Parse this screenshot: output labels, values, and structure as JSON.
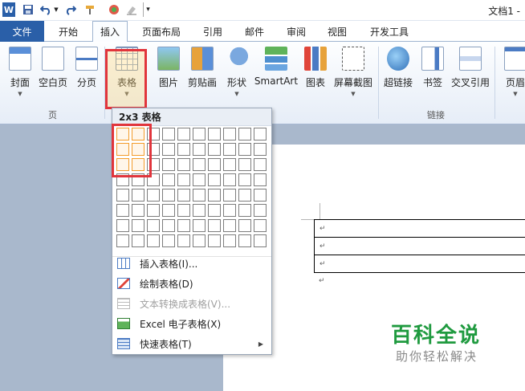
{
  "window": {
    "title": "文档1 -"
  },
  "quick_access": {
    "icons": [
      "word-app-icon",
      "save-icon",
      "undo-icon",
      "dropdown-icon",
      "redo-icon",
      "format-painter-icon",
      "color-icon",
      "eraser-icon",
      "customize-icon"
    ]
  },
  "tabs": [
    {
      "label": "文件"
    },
    {
      "label": "开始"
    },
    {
      "label": "插入"
    },
    {
      "label": "页面布局"
    },
    {
      "label": "引用"
    },
    {
      "label": "邮件"
    },
    {
      "label": "审阅"
    },
    {
      "label": "视图"
    },
    {
      "label": "开发工具"
    }
  ],
  "ribbon": {
    "buttons": [
      {
        "label": "封面"
      },
      {
        "label": "空白页"
      },
      {
        "label": "分页"
      },
      {
        "label": "表格"
      },
      {
        "label": "图片"
      },
      {
        "label": "剪贴画"
      },
      {
        "label": "形状"
      },
      {
        "label": "SmartArt"
      },
      {
        "label": "图表"
      },
      {
        "label": "屏幕截图"
      },
      {
        "label": "超链接"
      },
      {
        "label": "书签"
      },
      {
        "label": "交叉引用"
      },
      {
        "label": "页眉"
      }
    ],
    "groups": {
      "pages": "页",
      "links": "链接"
    }
  },
  "table_dropdown": {
    "header": "2x3 表格",
    "grid": {
      "columns": 10,
      "rows": 8,
      "selected_columns": 2,
      "selected_rows": 3
    },
    "menu": [
      {
        "label": "插入表格(I)...",
        "enabled": true,
        "icon": "insert-table-icon"
      },
      {
        "label": "绘制表格(D)",
        "enabled": true,
        "icon": "draw-table-icon"
      },
      {
        "label": "文本转换成表格(V)...",
        "enabled": false,
        "icon": "text-to-table-icon"
      },
      {
        "label": "Excel 电子表格(X)",
        "enabled": true,
        "icon": "excel-icon"
      },
      {
        "label": "快速表格(T)",
        "enabled": true,
        "icon": "quick-table-icon",
        "submenu": true
      }
    ]
  },
  "document": {
    "paragraph_mark": "↵"
  },
  "watermark": {
    "title": "百科全说",
    "subtitle": "助你轻松解决"
  },
  "colors": {
    "file_tab": "#2a5fa8",
    "highlight": "#e1353c",
    "selection": "#f39c2b",
    "watermark": "#1f9a3f"
  }
}
